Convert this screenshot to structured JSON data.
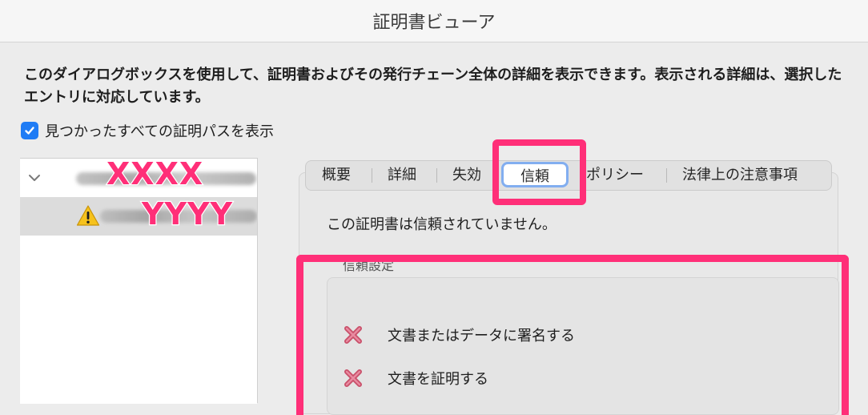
{
  "window": {
    "title": "証明書ビューア"
  },
  "description": "このダイアログボックスを使用して、証明書およびその発行チェーン全体の詳細を表示できます。表示される詳細は、選択したエントリに対応しています。",
  "show_all_paths": {
    "label": "見つかったすべての証明パスを表示",
    "checked": true
  },
  "tree": {
    "items": [
      {
        "annotation": "XXXX",
        "icon": "chevron-down-icon"
      },
      {
        "annotation": "YYYY",
        "icon": "warning-icon",
        "selected": true
      }
    ]
  },
  "tabs": [
    {
      "label": "概要"
    },
    {
      "label": "詳細"
    },
    {
      "label": "失効"
    },
    {
      "label": "信頼",
      "active": true
    },
    {
      "label": "ポリシー"
    },
    {
      "label": "法律上の注意事項"
    }
  ],
  "trust": {
    "message": "この証明書は信頼されていません。",
    "group_label": "信頼設定",
    "permissions": [
      {
        "label": "文書またはデータに署名する",
        "icon": "x-icon",
        "allowed": false
      },
      {
        "label": "文書を証明する",
        "icon": "x-icon",
        "allowed": false
      }
    ]
  },
  "colors": {
    "highlight": "#ff2f78",
    "accent": "#1f7cf5",
    "active_tab_border": "#82aef0"
  }
}
